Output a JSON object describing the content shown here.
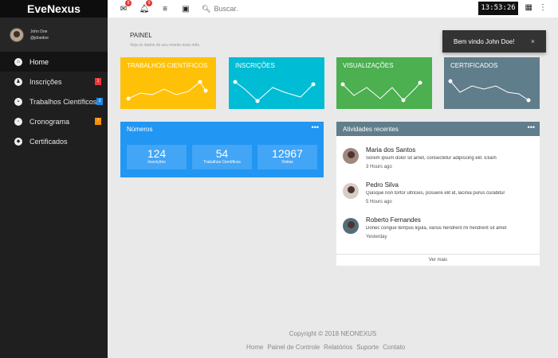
{
  "sidebar": {
    "brand": "EveNexus",
    "user": {
      "name": "John Doe",
      "handle": "@jdoedoe"
    },
    "items": [
      {
        "label": "Home",
        "icon": "home-icon",
        "active": true
      },
      {
        "label": "Inscrições",
        "icon": "group-icon",
        "badge": "1",
        "badge_color": "#e53935"
      },
      {
        "label": "Trabalhos Científicos",
        "icon": "document-icon",
        "badge": "3",
        "badge_color": "#1e88e5"
      },
      {
        "label": "Cronograma",
        "icon": "calendar-icon",
        "badge": "7",
        "badge_color": "#fb8c00"
      },
      {
        "label": "Certificados",
        "icon": "shield-icon"
      }
    ]
  },
  "topbar": {
    "mail_count": "8",
    "notif_count": "9",
    "search_placeholder": "Buscar.",
    "clock": "13:53:26"
  },
  "page": {
    "title": "PAINEL",
    "subtitle": "Veja os dados do seu evento esse mês"
  },
  "toast": {
    "text": "Bem vindo John Doe!",
    "close": "×"
  },
  "cards": [
    {
      "title": "TRABALHOS CIENTÍFICOS",
      "color": "#ffc107"
    },
    {
      "title": "INSCRIÇÕES",
      "color": "#00bcd4"
    },
    {
      "title": "VISUALIZAÇÕES",
      "color": "#4caf50"
    },
    {
      "title": "CERTIFICADOS",
      "color": "#607d8b"
    }
  ],
  "numeros": {
    "title": "Números",
    "more": "•••",
    "stats": [
      {
        "value": "124",
        "label": "Inscrições"
      },
      {
        "value": "54",
        "label": "Trabalhos Científicos"
      },
      {
        "value": "12967",
        "label": "Visitas"
      }
    ]
  },
  "atividades": {
    "title": "Atividades recentes",
    "more": "•••",
    "items": [
      {
        "name": "Maria dos Santos",
        "text": "Sorem ipsum dolor sit amet, consectetur adipiscing elit. Etiam",
        "time": "3 Hours ago"
      },
      {
        "name": "Pedro Silva",
        "text": "Quisque non tortor ultricies, posuere elit id, lacinia purus curabitur",
        "time": "5 Hours ago"
      },
      {
        "name": "Roberto Fernandes",
        "text": "Donec congue tempus ligula, varius hendrerit mi hendrerit sit amet",
        "time": "Yesterday"
      }
    ],
    "ver_mais": "Ver mais"
  },
  "footer": {
    "copyright": "Copyright © 2018 NEONEXUS",
    "links": [
      "Home",
      "Painel de Controle",
      "Relatórios",
      "Suporte",
      "Contato"
    ]
  }
}
